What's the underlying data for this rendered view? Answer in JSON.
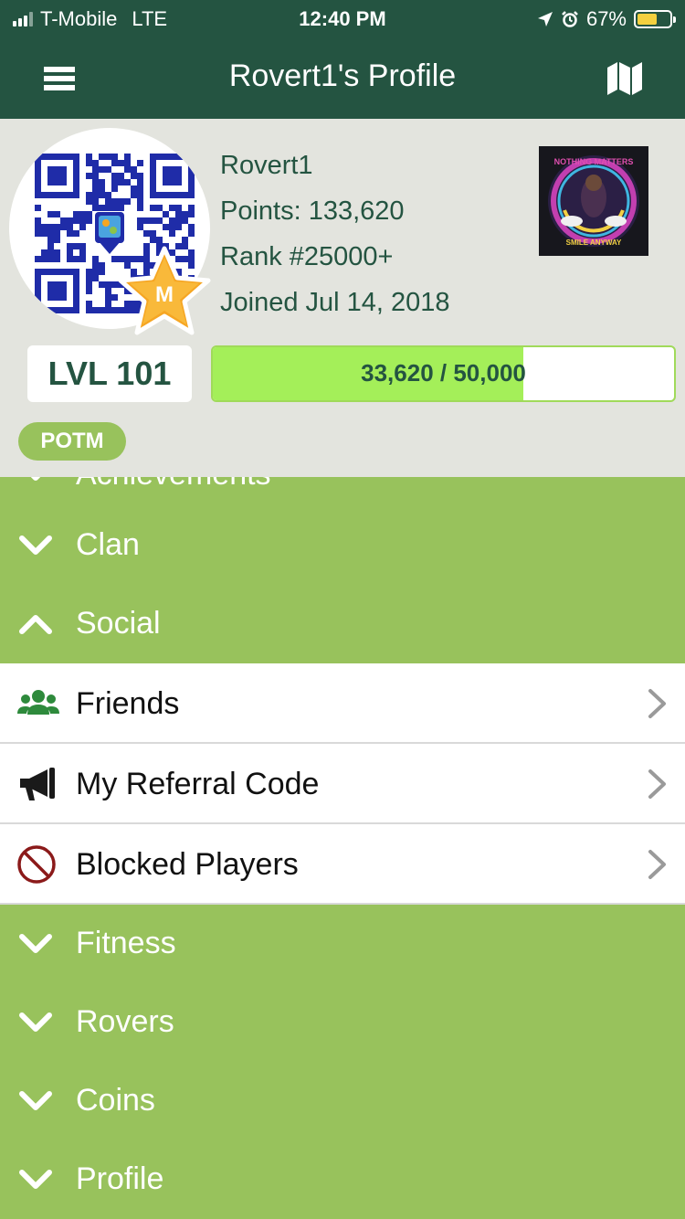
{
  "status_bar": {
    "carrier": "T-Mobile",
    "network": "LTE",
    "time": "12:40 PM",
    "battery_percent": "67%",
    "battery_level": 0.67
  },
  "navbar": {
    "title": "Rovert1's Profile",
    "left_icon": "menu-icon",
    "right_icon": "map-icon"
  },
  "profile": {
    "username": "Rovert1",
    "points": "Points: 133,620",
    "rank": "Rank #25000+",
    "joined": "Joined Jul 14, 2018",
    "badge_letter": "M",
    "level": "LVL 101",
    "xp_text": "33,620 / 50,000",
    "xp_fraction": 0.6724,
    "tag": "POTM",
    "thumb_text_top": "NOTHING MATTERS",
    "thumb_text_bottom": "SMILE ANYWAY"
  },
  "sections": {
    "achievements": "Achievements",
    "clan": "Clan",
    "social": "Social",
    "fitness": "Fitness",
    "rovers": "Rovers",
    "coins": "Coins",
    "profile": "Profile"
  },
  "social_items": [
    {
      "label": "Friends",
      "icon": "friends-icon"
    },
    {
      "label": "My Referral Code",
      "icon": "megaphone-icon"
    },
    {
      "label": "Blocked Players",
      "icon": "blocked-icon"
    }
  ],
  "colors": {
    "header": "#245441",
    "section_green": "#98c25c",
    "xp_fill": "#a4ef59",
    "profile_bg": "#e3e4de",
    "qr_blue": "#1f2ca8",
    "badge_orange": "#f6a623"
  }
}
